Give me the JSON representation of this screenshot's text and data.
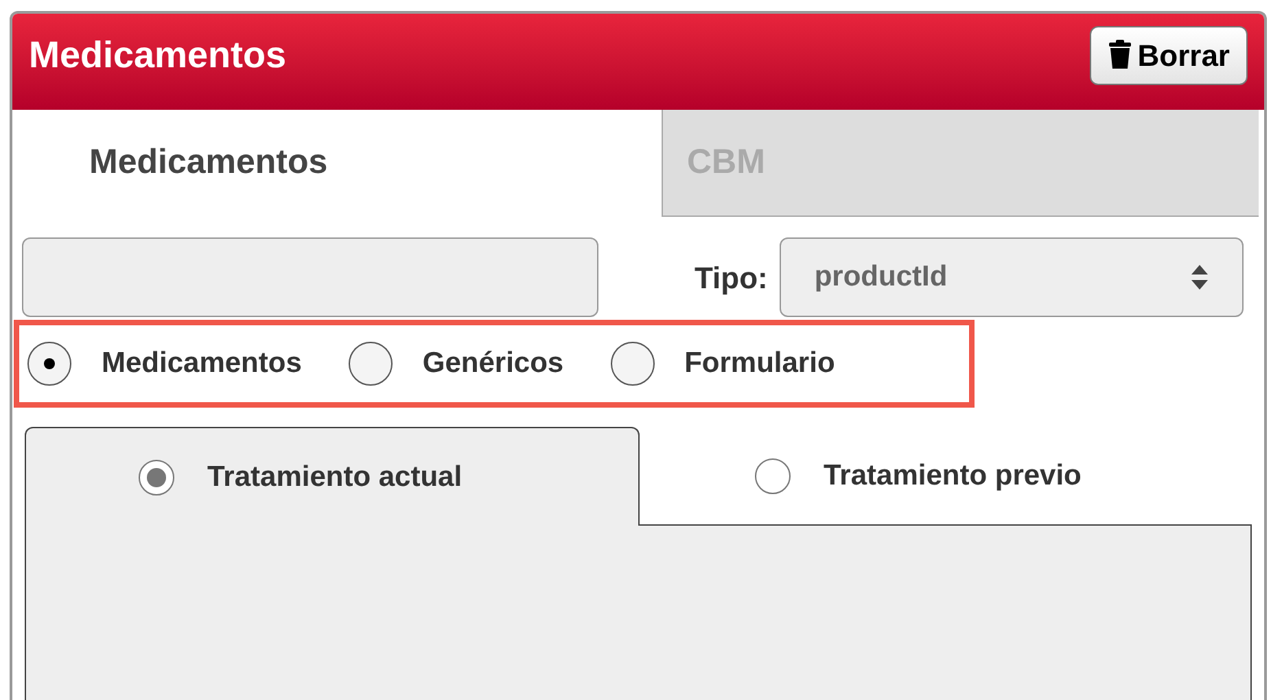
{
  "header": {
    "title": "Medicamentos",
    "button": "Borrar"
  },
  "tabs": [
    {
      "label": "Medicamentos",
      "selected": true
    },
    {
      "label": "CBM",
      "selected": false
    }
  ],
  "search": {
    "kind": "text-field"
  },
  "type_filter": {
    "label": "Tipo:",
    "value": "productId"
  },
  "source_options": [
    {
      "label": "Medicamentos",
      "selected": true
    },
    {
      "label": "Genéricos",
      "selected": false
    },
    {
      "label": "Formulario",
      "selected": false
    }
  ],
  "treatment_tabs": [
    {
      "label": "Tratamiento actual",
      "selected": true
    },
    {
      "label": "Tratamiento previo",
      "selected": false
    }
  ]
}
